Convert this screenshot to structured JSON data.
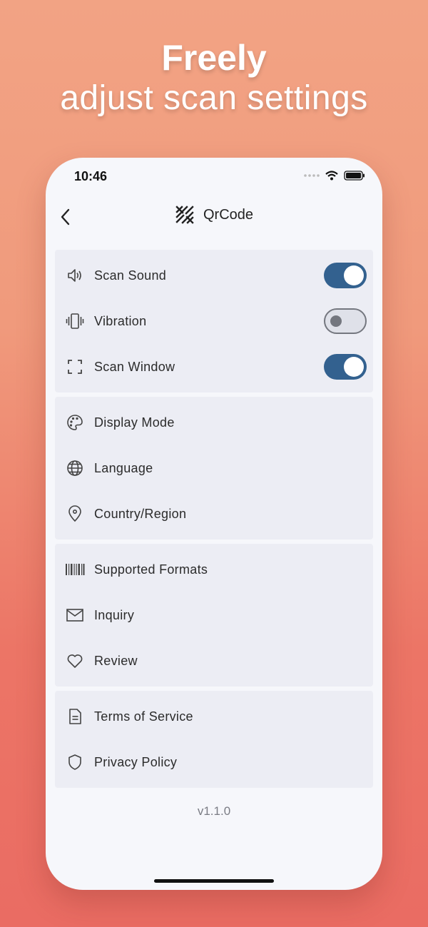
{
  "hero": {
    "line1": "Freely",
    "line2": "adjust scan settings"
  },
  "status_bar": {
    "time": "10:46",
    "icons": [
      "signal-icon",
      "wifi-icon",
      "battery-icon"
    ]
  },
  "nav": {
    "title": "QrCode",
    "back_icon": "chevron-left-icon",
    "logo_icon": "qrcode-logo-icon"
  },
  "settings": {
    "toggles": {
      "scan_sound": {
        "label": "Scan Sound",
        "on": true
      },
      "vibration": {
        "label": "Vibration",
        "on": false
      },
      "scan_window": {
        "label": "Scan Window",
        "on": true
      }
    },
    "display_mode": "Display Mode",
    "language": "Language",
    "country_region": "Country/Region",
    "supported_formats": "Supported Formats",
    "inquiry": "Inquiry",
    "review": "Review",
    "terms": "Terms of Service",
    "privacy": "Privacy Policy"
  },
  "version": "v1.1.0",
  "colors": {
    "accent": "#33618f",
    "card_bg": "#ecedf4",
    "screen_bg": "#f6f7fb"
  }
}
